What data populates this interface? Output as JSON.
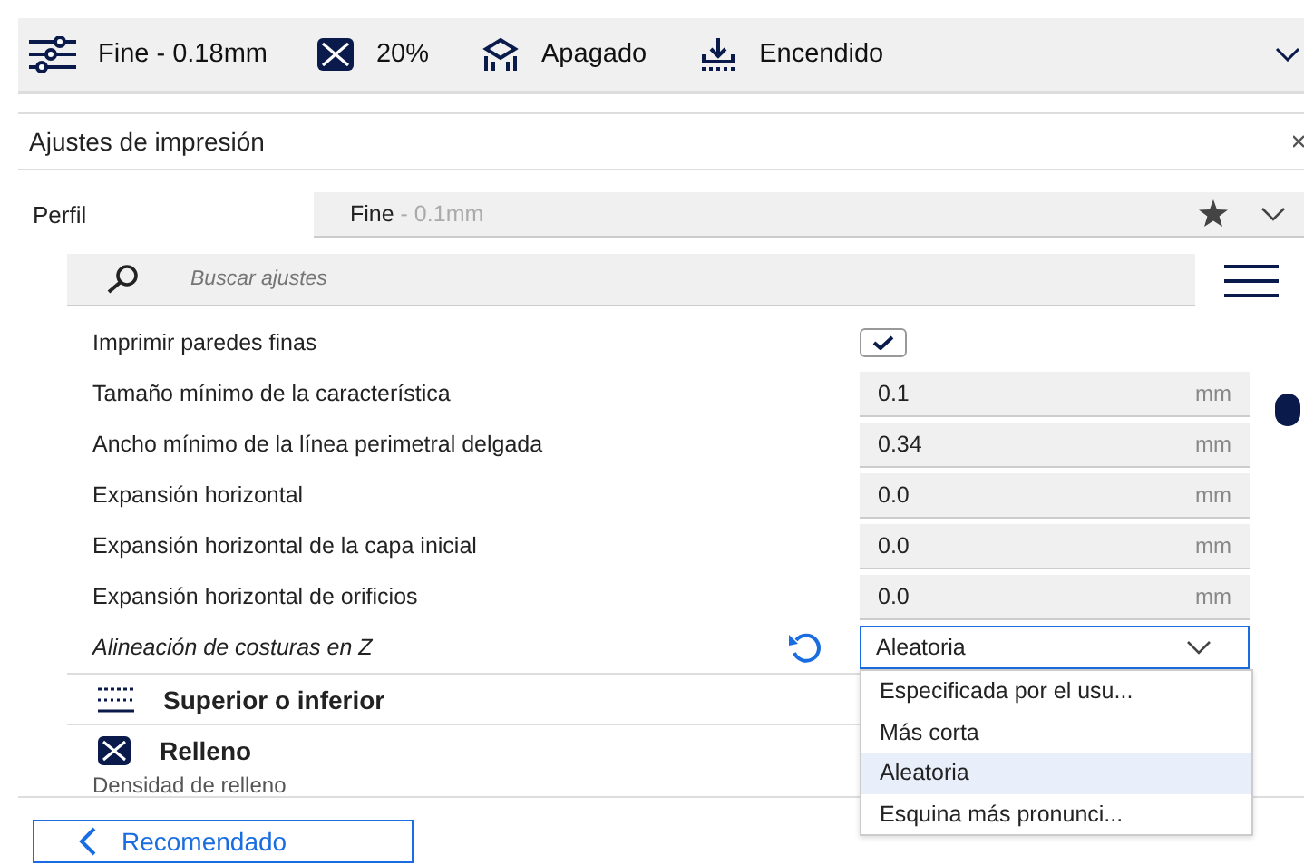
{
  "top_bar": {
    "items": [
      {
        "kind": "profile",
        "label": "Fine - 0.18mm"
      },
      {
        "kind": "infill",
        "label": "20%"
      },
      {
        "kind": "support",
        "label": "Apagado"
      },
      {
        "kind": "adhesion",
        "label": "Encendido"
      }
    ]
  },
  "panel": {
    "title": "Ajustes de impresión",
    "profile_label": "Perfil",
    "profile_name": "Fine",
    "profile_detail": " - 0.1mm"
  },
  "search": {
    "placeholder": "Buscar ajustes"
  },
  "settings": [
    {
      "kind": "checkbox",
      "label": "Imprimir paredes finas",
      "checked": true
    },
    {
      "kind": "number",
      "label": "Tamaño mínimo de la característica",
      "value": "0.1",
      "unit": "mm"
    },
    {
      "kind": "number",
      "label": "Ancho mínimo de la línea perimetral delgada",
      "value": "0.34",
      "unit": "mm"
    },
    {
      "kind": "number",
      "label": "Expansión horizontal",
      "value": "0.0",
      "unit": "mm"
    },
    {
      "kind": "number",
      "label": "Expansión horizontal de la capa inicial",
      "value": "0.0",
      "unit": "mm"
    },
    {
      "kind": "number",
      "label": "Expansión horizontal de orificios",
      "value": "0.0",
      "unit": "mm"
    },
    {
      "kind": "select",
      "label": "Alineación de costuras en Z",
      "value": "Aleatoria",
      "modified": true,
      "expanded": true,
      "options": [
        {
          "label": "Especificada por el usu...",
          "selected": false
        },
        {
          "label": "Más corta",
          "selected": false
        },
        {
          "label": "Aleatoria",
          "selected": true
        },
        {
          "label": "Esquina más pronunci...",
          "selected": false
        }
      ]
    }
  ],
  "categories": [
    {
      "kind": "top_bottom",
      "label": "Superior o inferior"
    },
    {
      "kind": "infill",
      "label": "Relleno"
    }
  ],
  "next_setting": "Densidad de relleno",
  "footer": {
    "button": "Recomendado"
  }
}
